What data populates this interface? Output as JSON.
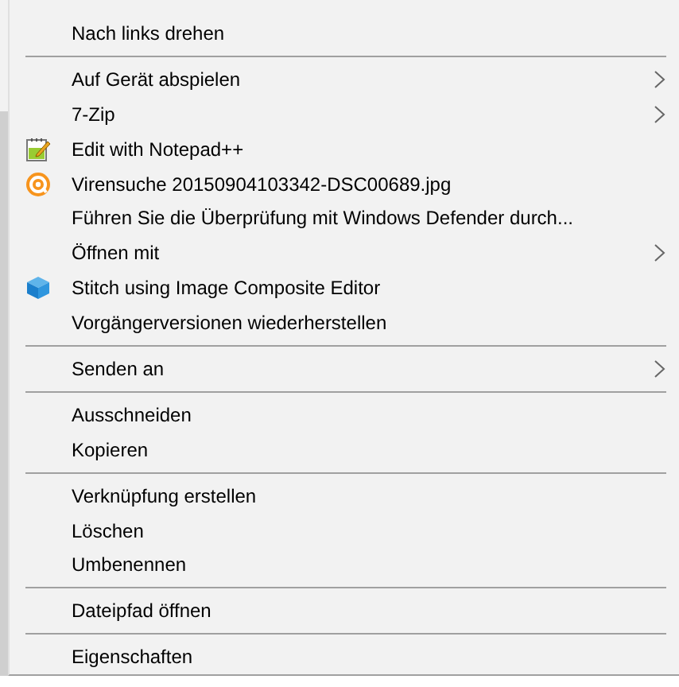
{
  "menu": {
    "entries": [
      {
        "kind": "text",
        "label": "Nach links drehen",
        "submenu": false
      },
      {
        "kind": "separator"
      },
      {
        "kind": "text",
        "label": "Auf Gerät abspielen",
        "submenu": true
      },
      {
        "kind": "text",
        "label": "7-Zip",
        "submenu": true
      },
      {
        "kind": "notepad",
        "label": "Edit with Notepad++",
        "submenu": false
      },
      {
        "kind": "scan",
        "label": "Virensuche 20150904103342-DSC00689.jpg",
        "submenu": false
      },
      {
        "kind": "text",
        "label": "Führen Sie die Überprüfung mit Windows Defender durch...",
        "submenu": false
      },
      {
        "kind": "text",
        "label": "Öffnen mit",
        "submenu": true
      },
      {
        "kind": "stitch",
        "label": "Stitch using Image Composite Editor",
        "submenu": false
      },
      {
        "kind": "text",
        "label": "Vorgängerversionen wiederherstellen",
        "submenu": false
      },
      {
        "kind": "separator"
      },
      {
        "kind": "text",
        "label": "Senden an",
        "submenu": true
      },
      {
        "kind": "separator"
      },
      {
        "kind": "text",
        "label": "Ausschneiden",
        "submenu": false
      },
      {
        "kind": "text",
        "label": "Kopieren",
        "submenu": false
      },
      {
        "kind": "separator"
      },
      {
        "kind": "text",
        "label": "Verknüpfung erstellen",
        "submenu": false
      },
      {
        "kind": "text",
        "label": "Löschen",
        "submenu": false
      },
      {
        "kind": "text",
        "label": "Umbenennen",
        "submenu": false
      },
      {
        "kind": "separator"
      },
      {
        "kind": "text",
        "label": "Dateipfad öffnen",
        "submenu": false
      },
      {
        "kind": "separator"
      },
      {
        "kind": "text",
        "label": "Eigenschaften",
        "submenu": false
      }
    ]
  }
}
